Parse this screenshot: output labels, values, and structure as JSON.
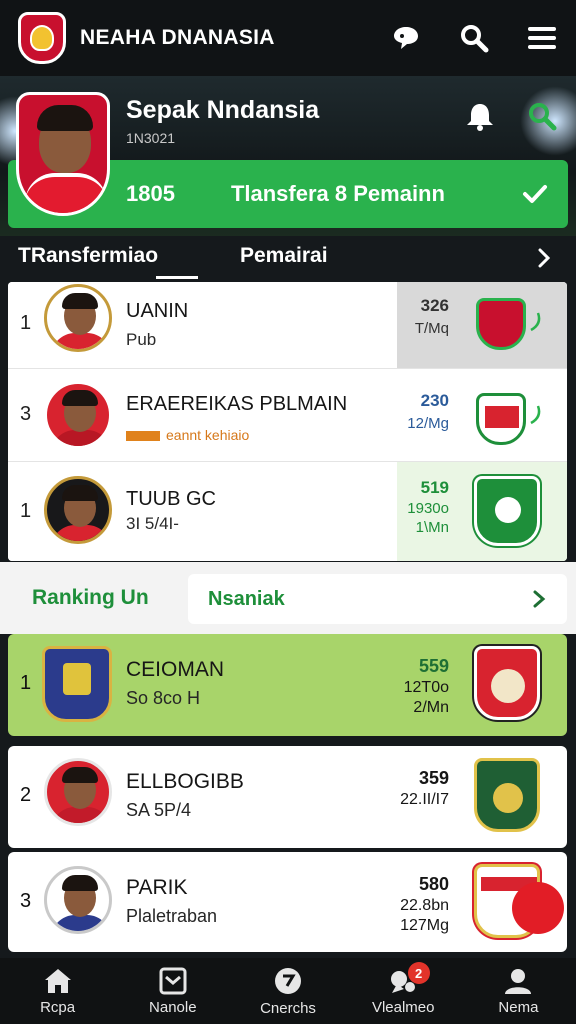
{
  "header": {
    "title": "NEAHA DNANASIA",
    "icons": [
      "chat-bubble-icon",
      "search-icon",
      "menu-icon"
    ]
  },
  "hero": {
    "name": "Sepak Nndansia",
    "subtitle": "1N3021",
    "banner_number": "1805",
    "banner_text": "Tlansfera 8 Pemainn"
  },
  "tabs": [
    {
      "label": "TRansfermiao"
    },
    {
      "label": "Pemairai"
    }
  ],
  "transfer_list": [
    {
      "rank": "1",
      "name": "UANIN",
      "sub": "Pub",
      "stat_a": "326",
      "stat_b": "T/Mq",
      "avatar_style": "white",
      "crest_color": "#c8102e"
    },
    {
      "rank": "3",
      "name": "ERAEREIKAS PBLMAIN",
      "sub": "eannt kehiaio",
      "stat_a": "230",
      "stat_b": "12/Mg",
      "avatar_style": "red",
      "crest_color": "#d8232f"
    },
    {
      "rank": "1",
      "name": "TUUB GC",
      "sub": "3I 5/4I-",
      "stat_a": "519",
      "stat_b": "1930o",
      "stat_c": "1\\Mn",
      "avatar_style": "dark",
      "crest_color": "#1e8f3a"
    }
  ],
  "ranking": {
    "label": "Ranking Un",
    "pill_label": "Nsaniak"
  },
  "ranking_list": [
    {
      "rank": "1",
      "name": "CEIOMAN",
      "sub": "So 8co H",
      "stat_a": "559",
      "stat_b": "12T0o",
      "stat_c": "2/Mn",
      "highlight": true
    },
    {
      "rank": "2",
      "name": "ELLBOGIBB",
      "sub": "SA 5P/4",
      "stat_a": "359",
      "stat_b": "22.II/I7",
      "stat_c": "",
      "highlight": false
    },
    {
      "rank": "3",
      "name": "PARIK",
      "sub": "Plaletraban",
      "stat_a": "580",
      "stat_b": "22.8bn",
      "stat_c": "127Mg",
      "highlight": false
    }
  ],
  "bottom_nav": [
    {
      "label": "Rcpa",
      "icon": "home-icon"
    },
    {
      "label": "Nanole",
      "icon": "inbox-icon"
    },
    {
      "label": "Cnerchs",
      "icon": "ball-icon"
    },
    {
      "label": "Vlealmeo",
      "icon": "notification-icon",
      "badge": "2"
    },
    {
      "label": "Nema",
      "icon": "profile-icon"
    }
  ],
  "colors": {
    "accent_green": "#2ab24d",
    "ranking_green": "#1e8f3a",
    "highlight_lime": "#a8d46a",
    "brand_red": "#c8102e"
  }
}
